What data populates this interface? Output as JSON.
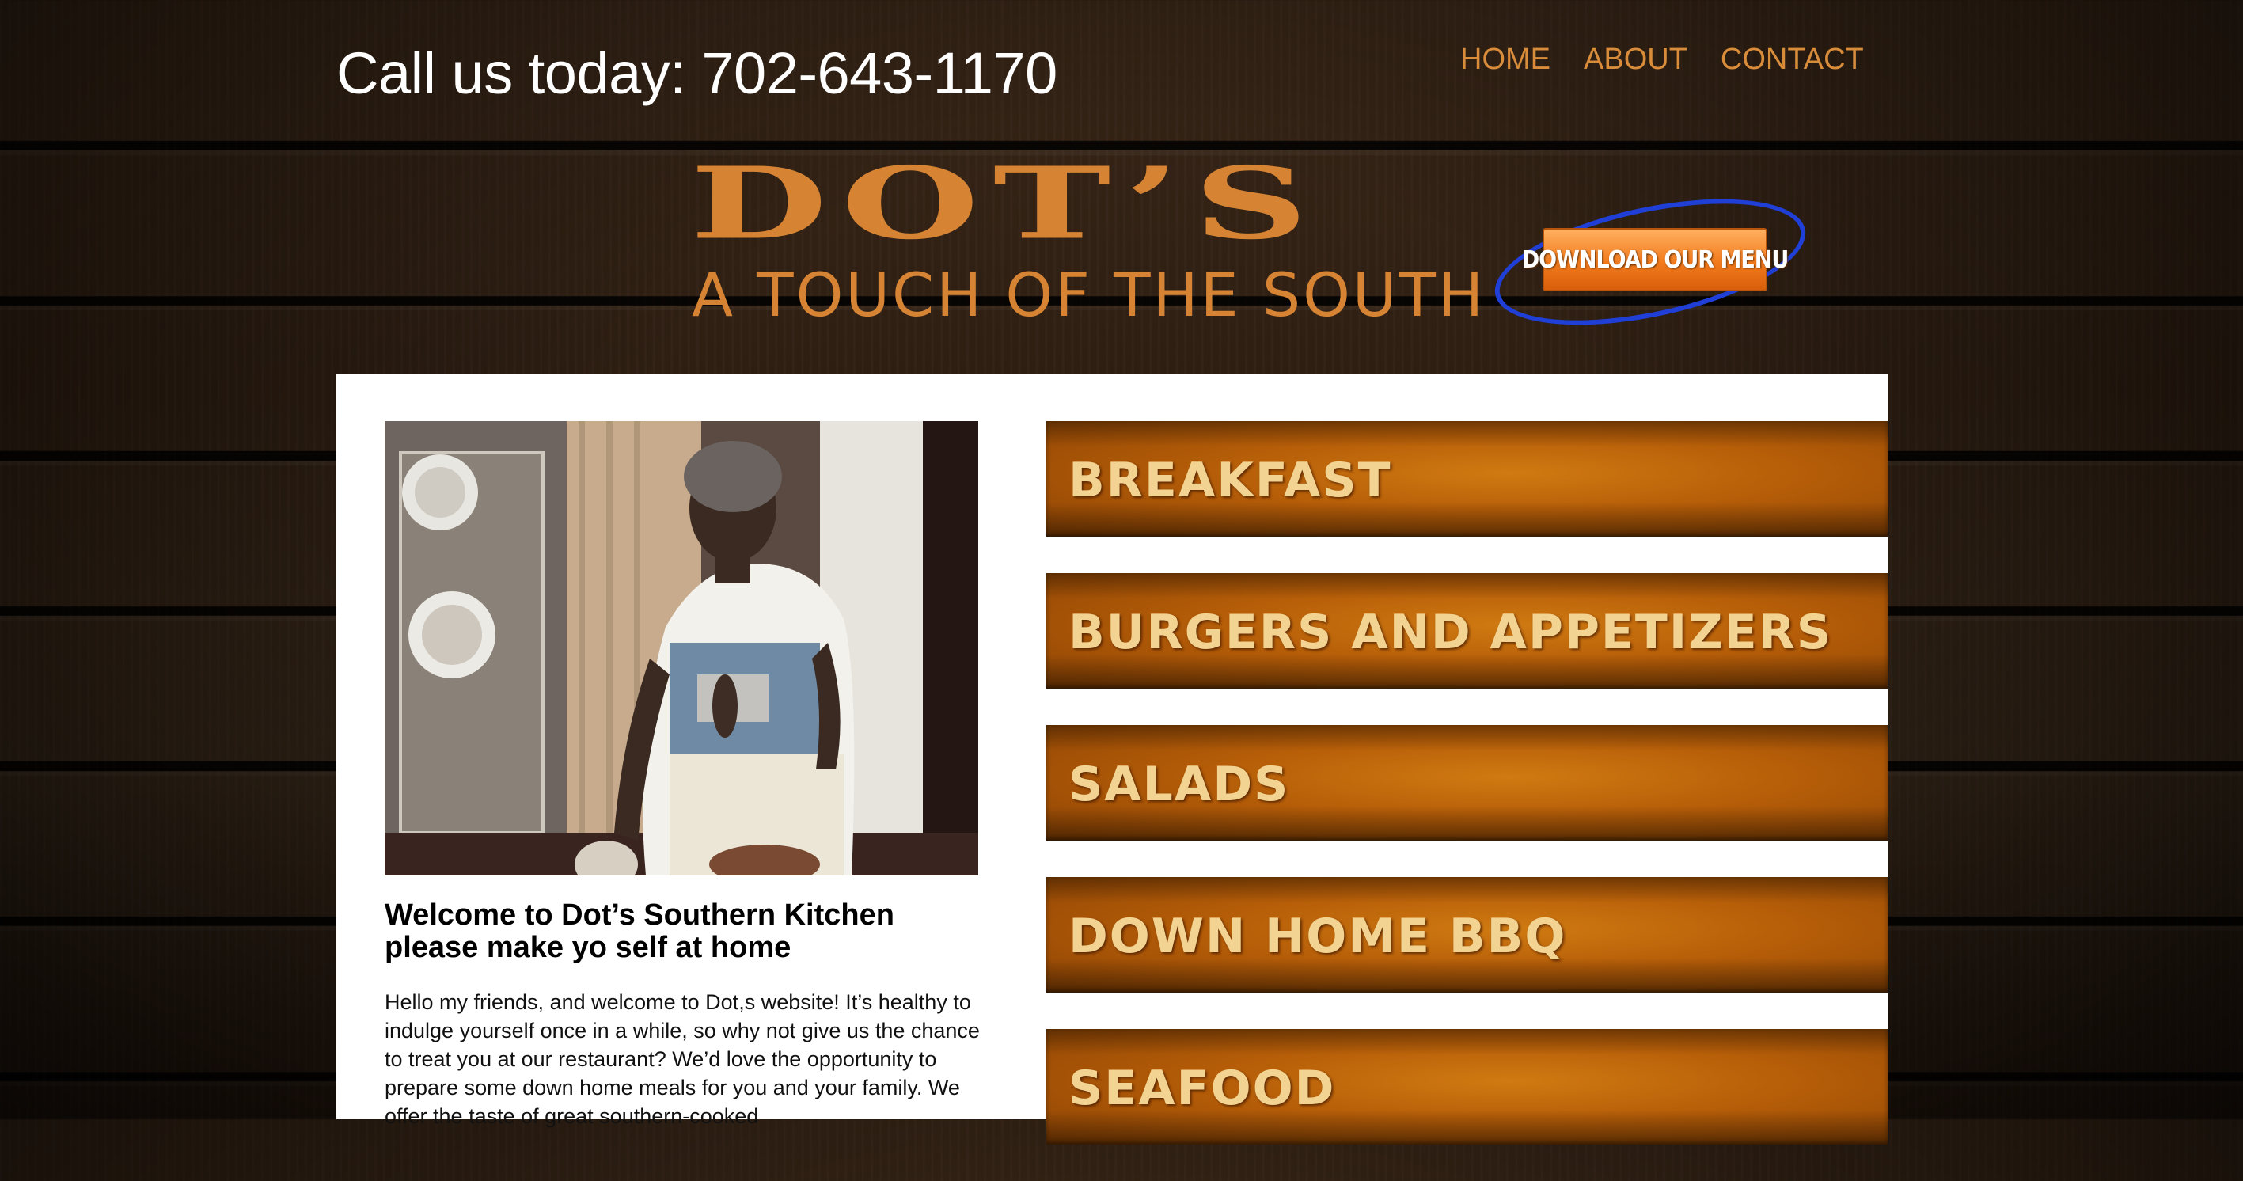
{
  "header": {
    "call_text": "Call us today: 702-643-1170",
    "nav": [
      "HOME",
      "ABOUT",
      "CONTACT"
    ]
  },
  "logo": {
    "title": "DOT’S",
    "tagline": "A TOUCH OF THE SOUTH"
  },
  "download_button": {
    "label": "DOWNLOAD OUR MENU"
  },
  "main": {
    "welcome_title": "Welcome to Dot’s Southern Kitchen please make yo self at home",
    "welcome_body": "Hello my friends, and welcome to Dot,s website! It’s healthy to indulge yourself once in a while, so why not give us the chance to treat you at our restaurant? We’d love the opportunity to prepare some down home meals for you and your family. We offer the taste of great southern-cooked",
    "menu_categories": [
      "BREAKFAST",
      "BURGERS AND APPETIZERS",
      "SALADS",
      "DOWN HOME BBQ",
      "SEAFOOD"
    ]
  },
  "colors": {
    "accent": "#d98d3a",
    "logo": "#d68434",
    "button": "#f27a1c",
    "ring": "#1f3fd6",
    "menu_bar": "#b55d08",
    "menu_text": "#f3d391"
  },
  "icons": [
    "owner-photo"
  ]
}
